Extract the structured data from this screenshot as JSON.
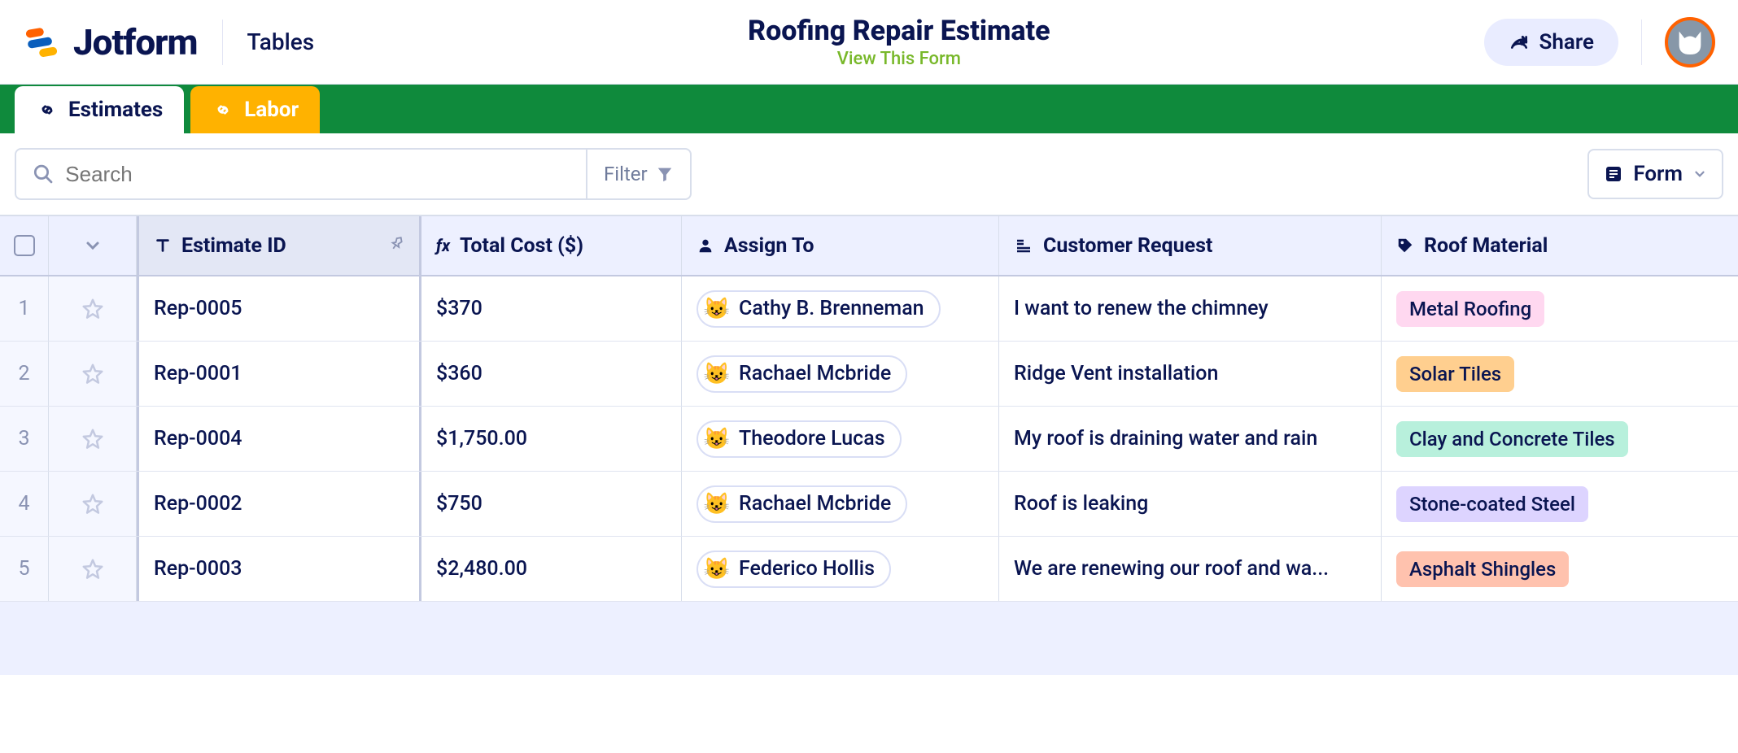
{
  "header": {
    "brand": "Jotform",
    "section": "Tables",
    "title": "Roofing Repair Estimate",
    "view_link": "View This Form",
    "share_label": "Share"
  },
  "tabs": [
    {
      "label": "Estimates",
      "active": true
    },
    {
      "label": "Labor",
      "active": false
    }
  ],
  "toolbar": {
    "search_placeholder": "Search",
    "filter_label": "Filter",
    "form_label": "Form"
  },
  "columns": [
    {
      "key": "estimate_id",
      "label": "Estimate ID",
      "icon": "text-icon",
      "sorted": true,
      "pinned": true
    },
    {
      "key": "total_cost",
      "label": "Total Cost ($)",
      "icon": "fx-icon"
    },
    {
      "key": "assign_to",
      "label": "Assign To",
      "icon": "person-icon"
    },
    {
      "key": "customer_request",
      "label": "Customer Request",
      "icon": "paragraph-icon"
    },
    {
      "key": "roof_material",
      "label": "Roof Material",
      "icon": "tag-icon"
    }
  ],
  "material_colors": {
    "Metal Roofing": "#ffd8f0",
    "Solar Tiles": "#ffcf8f",
    "Clay and Concrete Tiles": "#b8f0dc",
    "Stone-coated Steel": "#ddd4ff",
    "Asphalt Shingles": "#ffc2ae"
  },
  "rows": [
    {
      "n": "1",
      "estimate_id": "Rep-0005",
      "total_cost": "$370",
      "assign_to": "Cathy B. Brenneman",
      "customer_request": "I want to renew the chimney",
      "roof_material": "Metal Roofing"
    },
    {
      "n": "2",
      "estimate_id": "Rep-0001",
      "total_cost": "$360",
      "assign_to": "Rachael Mcbride",
      "customer_request": "Ridge Vent installation",
      "roof_material": "Solar Tiles"
    },
    {
      "n": "3",
      "estimate_id": "Rep-0004",
      "total_cost": "$1,750.00",
      "assign_to": "Theodore Lucas",
      "customer_request": "My roof is draining water and rain",
      "roof_material": "Clay and Concrete Tiles"
    },
    {
      "n": "4",
      "estimate_id": "Rep-0002",
      "total_cost": "$750",
      "assign_to": "Rachael Mcbride",
      "customer_request": "Roof is leaking",
      "roof_material": "Stone-coated Steel"
    },
    {
      "n": "5",
      "estimate_id": "Rep-0003",
      "total_cost": "$2,480.00",
      "assign_to": "Federico Hollis",
      "customer_request": "We are renewing our roof and wa...",
      "roof_material": "Asphalt Shingles"
    }
  ]
}
